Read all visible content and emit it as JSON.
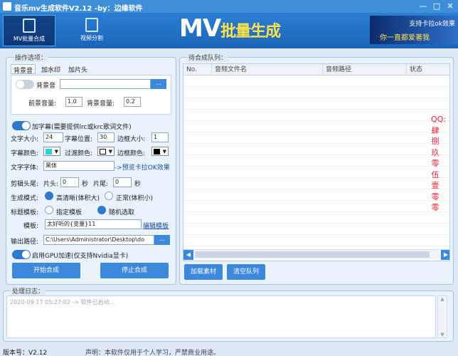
{
  "window": {
    "title": "音乐mv生成软件V2.12 -by：边缘软件",
    "minimize": "—",
    "maximize": "□",
    "close": "✕"
  },
  "nav": [
    {
      "label": "MV批量合成",
      "icon": "video-edit-icon",
      "selected": true
    },
    {
      "label": "视频分割",
      "icon": "film-split-icon",
      "selected": false
    }
  ],
  "logo": {
    "main": "MV",
    "sub": "批量生成"
  },
  "banner": {
    "line1": "支持卡拉ok效果",
    "line2": "你一直都爱著我"
  },
  "options": {
    "legend": "操作选项：",
    "tabs": [
      "背景音",
      "加水印",
      "加片头"
    ],
    "bg_music": {
      "label": "背景音",
      "path": "",
      "browse": "...",
      "fg_vol_label": "前景音量:",
      "fg_vol": "1.0",
      "bg_vol_label": "背景音量:",
      "bg_vol": "0.2"
    },
    "subtitle": {
      "label": "加字幕(需要提供lrc或krc歌词文件)",
      "size_label": "文字大小:",
      "size": "24",
      "pos_label": "字幕位置:",
      "pos": "30",
      "border_label": "边框大小:",
      "border": "1",
      "color_label": "字幕颜色:",
      "fade_label": "过渡颜色:",
      "border_color_label": "边框颜色:",
      "font_label": "文字字体:",
      "font": "黑体",
      "karaoke_link": "->预览卡拉OK效果",
      "sub_color": "#27d4d4",
      "fade_color": "#ffffff",
      "border_color": "#000000"
    },
    "trim": {
      "label": "剪辑头尾:",
      "head_label": "片头:",
      "head": "0",
      "head_unit": "秒",
      "tail_label": "片尾:",
      "tail": "0",
      "tail_unit": "秒"
    },
    "mode": {
      "label": "生成模式:",
      "opt1": "高清晰(体积大)",
      "opt2": "正常(体积小)"
    },
    "template": {
      "label": "标题模板:",
      "opt1": "指定模板",
      "opt2": "随机选取",
      "tmpl_label": "模板:",
      "tmpl_value": "太好听的{变量}11",
      "edit_link": "编辑模板"
    },
    "output": {
      "label": "输出路径:",
      "path": "C:\\Users\\Administrator\\Desktop\\do",
      "browse": "..."
    },
    "gpu": {
      "label": "启用GPU加速(仅支持Nvidia显卡)"
    },
    "start": "开始合成",
    "stop": "停止合成"
  },
  "queue": {
    "legend": "待合成队列：",
    "columns": [
      "No.",
      "音频文件名",
      "音频路径",
      "状态"
    ],
    "load_btn": "加载素材",
    "clear_btn": "清空队列",
    "qq_text": "QQ:肆捌玖零伍壹零零"
  },
  "log": {
    "legend": "处理日志：",
    "entry": "2020-09-17 05:27:02 -> 软件已启动..."
  },
  "status": {
    "version": "版本号：V2.12",
    "notice": "声明：本软件仅用于个人学习，严禁商业用途。"
  },
  "colors": {
    "accent": "#2e78d0",
    "header": "#1c64b8",
    "qq_red": "#e22233"
  }
}
